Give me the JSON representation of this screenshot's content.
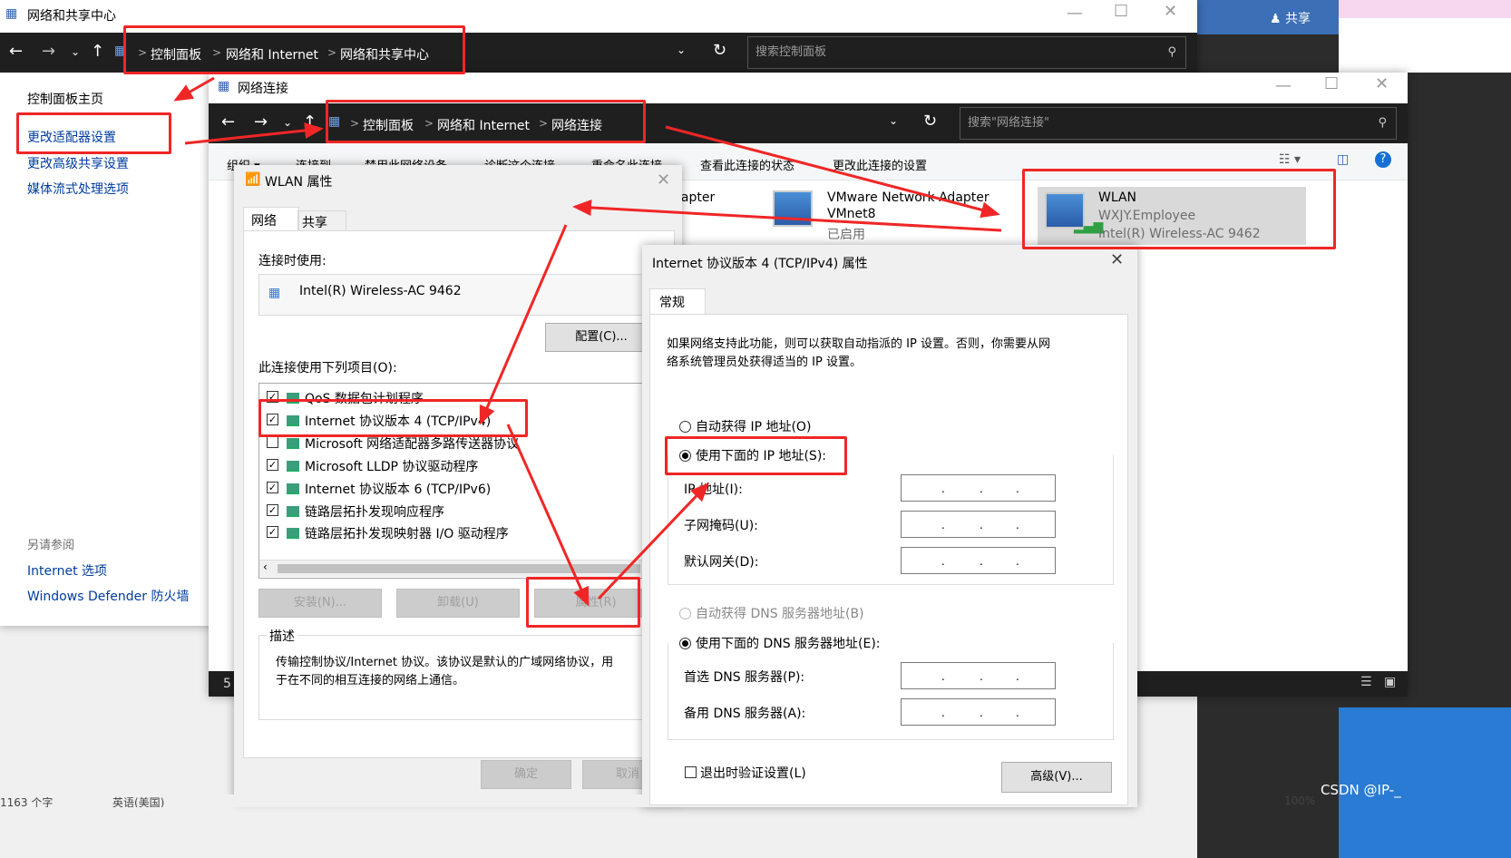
{
  "main_window": {
    "title": "网络和共享中心",
    "breadcrumb": [
      "控制面板",
      "网络和 Internet",
      "网络和共享中心"
    ],
    "search_placeholder": "搜索控制面板",
    "sidebar": [
      "控制面板主页",
      "更改适配器设置",
      "更改高级共享设置",
      "媒体流式处理选项"
    ],
    "see_also_title": "另请参阅",
    "see_also": [
      "Internet 选项",
      "Windows Defender 防火墙"
    ],
    "share_label": "共享"
  },
  "network_connections": {
    "title": "网络连接",
    "breadcrumb": [
      "控制面板",
      "网络和 Internet",
      "网络连接"
    ],
    "search_placeholder": "搜索\"网络连接\"",
    "toolbar": [
      "组织 ▾",
      "连接到",
      "禁用此网络设备",
      "诊断这个连接",
      "重命名此连接",
      "查看此连接的状态",
      "更改此连接的设置"
    ],
    "adapters": [
      {
        "name": "dapter",
        "line2": "",
        "line3": ""
      },
      {
        "name": "VMware Network Adapter",
        "line2": "VMnet8",
        "line3": "已启用"
      },
      {
        "name": "WLAN",
        "line2": "WXJY.Employee",
        "line3": "Intel(R) Wireless-AC 9462"
      }
    ],
    "status_count": "5"
  },
  "wlan_props": {
    "title": "WLAN 属性",
    "tabs": [
      "网络",
      "共享"
    ],
    "connect_using_label": "连接时使用:",
    "adapter_name": "Intel(R) Wireless-AC 9462",
    "configure_button": "配置(C)...",
    "items_label": "此连接使用下列项目(O):",
    "items": [
      {
        "label": "QoS 数据包计划程序",
        "checked": true
      },
      {
        "label": "Internet 协议版本 4 (TCP/IPv4)",
        "checked": true
      },
      {
        "label": "Microsoft 网络适配器多路传送器协议",
        "checked": false
      },
      {
        "label": "Microsoft LLDP 协议驱动程序",
        "checked": true
      },
      {
        "label": "Internet 协议版本 6 (TCP/IPv6)",
        "checked": true
      },
      {
        "label": "链路层拓扑发现响应程序",
        "checked": true
      },
      {
        "label": "链路层拓扑发现映射器 I/O 驱动程序",
        "checked": true
      }
    ],
    "install_button": "安装(N)...",
    "uninstall_button": "卸载(U)",
    "properties_button": "属性(R)",
    "description_title": "描述",
    "description_line1": "传输控制协议/Internet 协议。该协议是默认的广域网络协议，用",
    "description_line2": "于在不同的相互连接的网络上通信。",
    "ok_button": "确定",
    "cancel_button": "取消"
  },
  "ipv4_props": {
    "title": "Internet 协议版本 4 (TCP/IPv4) 属性",
    "tab": "常规",
    "intro_line1": "如果网络支持此功能，则可以获取自动指派的 IP 设置。否则，你需要从网",
    "intro_line2": "络系统管理员处获得适当的 IP 设置。",
    "auto_ip": "自动获得 IP 地址(O)",
    "manual_ip": "使用下面的 IP 地址(S):",
    "ip_address": "IP 地址(I):",
    "subnet_mask": "子网掩码(U):",
    "gateway": "默认网关(D):",
    "auto_dns": "自动获得 DNS 服务器地址(B)",
    "manual_dns": "使用下面的 DNS 服务器地址(E):",
    "preferred_dns": "首选 DNS 服务器(P):",
    "alternate_dns": "备用 DNS 服务器(A):",
    "validate_on_exit": "退出时验证设置(L)",
    "advanced_button": "高级(V)..."
  },
  "taskbar": {
    "word_count": "1163 个字",
    "language": "英语(美国)",
    "zoom": "100%",
    "watermark": "CSDN @IP-_"
  },
  "colors": {
    "annotation": "#f02626",
    "navbar": "#1f1f1f",
    "link": "#003c9e"
  }
}
